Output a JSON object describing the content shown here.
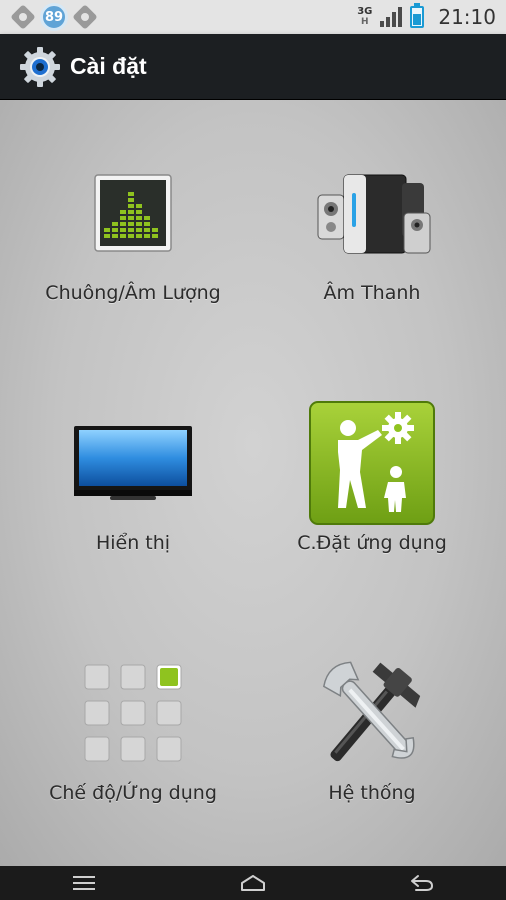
{
  "status_bar": {
    "notification_count": "89",
    "network_type": "3G",
    "network_sub": "H",
    "time": "21:10",
    "icons": [
      "app-notification-icon",
      "badge-89-icon",
      "app-notification-icon",
      "signal-icon",
      "battery-charging-icon"
    ]
  },
  "action_bar": {
    "title": "Cài đặt",
    "icon": "settings-gear-icon"
  },
  "tiles": [
    {
      "label": "Chuông/Âm Lượng",
      "icon": "equalizer-icon"
    },
    {
      "label": "Âm Thanh",
      "icon": "speakers-icon"
    },
    {
      "label": "Hiển thị",
      "icon": "monitor-icon"
    },
    {
      "label": "C.Đặt ứng dụng",
      "icon": "app-settings-icon"
    },
    {
      "label": "Chế độ/Ứng dụng",
      "icon": "grid-apps-icon"
    },
    {
      "label": "Hệ thống",
      "icon": "tools-icon"
    }
  ],
  "nav_bar": {
    "buttons": [
      "menu-icon",
      "home-icon",
      "back-icon"
    ]
  },
  "colors": {
    "action_bar": "#1c1f22",
    "status_bar": "#e4e4e4",
    "accent_green": "#8fc31f",
    "screen_blue": "#2f8de0"
  }
}
